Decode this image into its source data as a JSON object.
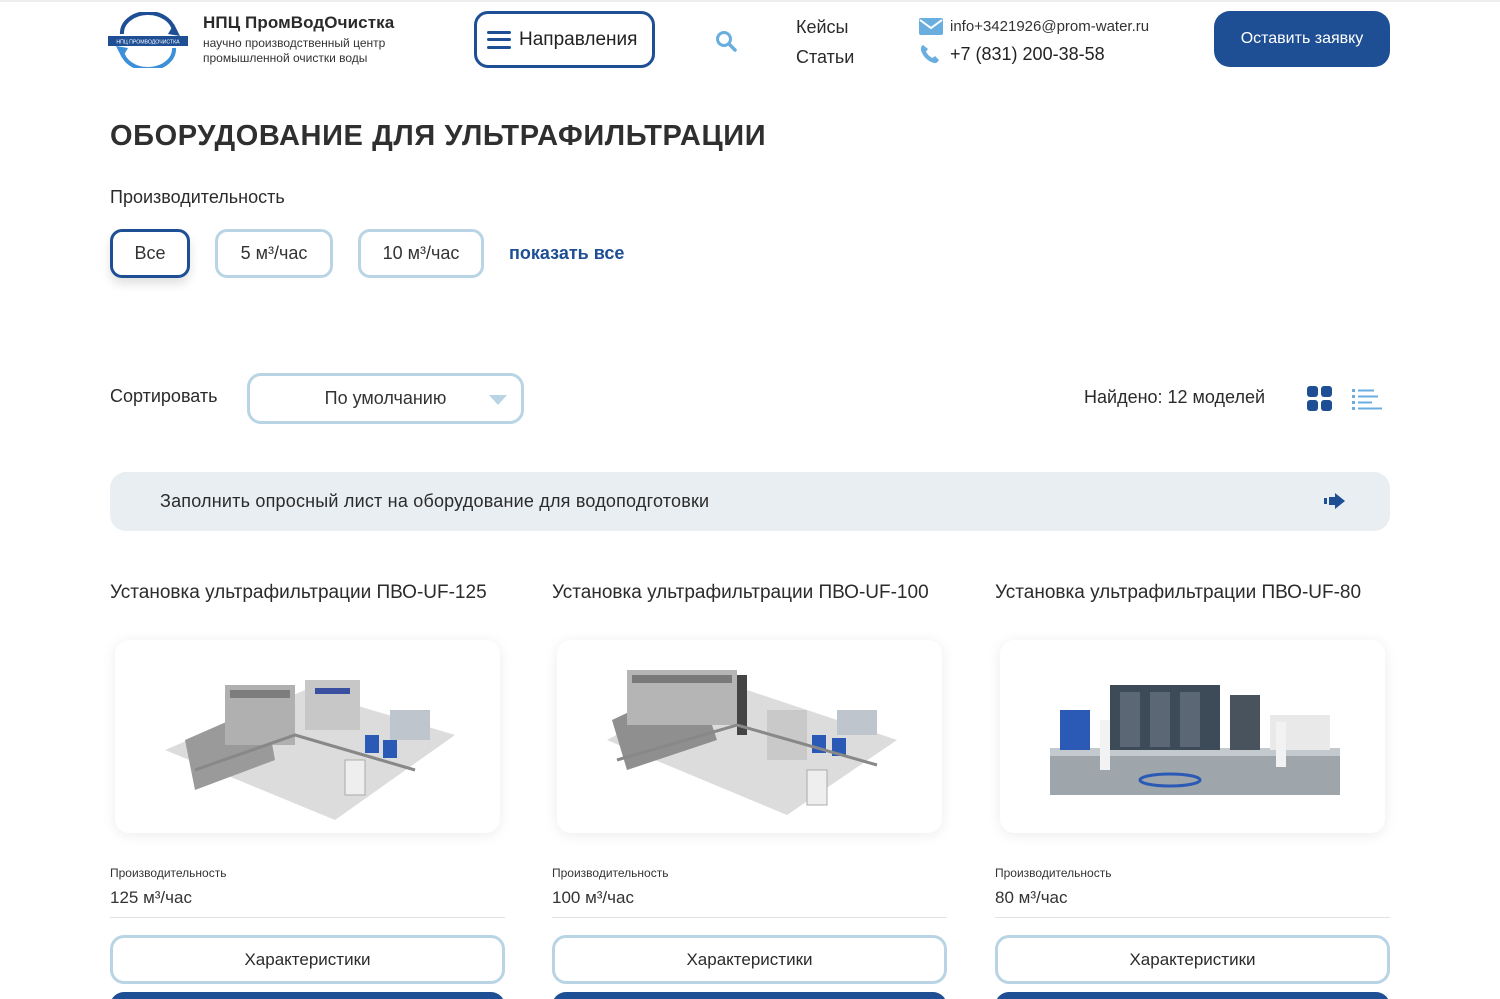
{
  "header": {
    "brand_name": "НПЦ ПромВодОчистка",
    "brand_sub": "научно производственный центр промышленной очистки воды",
    "logo_text": "НПЦ ПРОМВОДОЧИСТКА",
    "directions_label": "Направления",
    "nav": [
      {
        "label": "Кейсы"
      },
      {
        "label": "Статьи"
      }
    ],
    "email": "info+3421926@prom-water.ru",
    "phone": "+7 (831) 200-38-58",
    "cta_label": "Оставить заявку"
  },
  "page": {
    "title": "ОБОРУДОВАНИЕ ДЛЯ УЛЬТРАФИЛЬТРАЦИИ"
  },
  "filter": {
    "label": "Производительность",
    "chips": [
      {
        "label": "Все",
        "active": true
      },
      {
        "label": "5 м³/час",
        "active": false
      },
      {
        "label": "10 м³/час",
        "active": false
      }
    ],
    "show_all": "показать все"
  },
  "sort": {
    "label": "Сортировать",
    "selected": "По умолчанию",
    "found": "Найдено: 12 моделей"
  },
  "banner": {
    "text": "Заполнить опросный лист на оборудование для водоподготовки"
  },
  "products": [
    {
      "title": "Установка ультрафильтрации ПВО-UF-125",
      "spec_label": "Производительность",
      "spec_value": "125 м³/час",
      "button": "Характеристики"
    },
    {
      "title": "Установка ультрафильтрации ПВО-UF-100",
      "spec_label": "Производительность",
      "spec_value": "100 м³/час",
      "button": "Характеристики"
    },
    {
      "title": "Установка ультрафильтрации ПВО-UF-80",
      "spec_label": "Производительность",
      "spec_value": "80 м³/час",
      "button": "Характеристики"
    }
  ],
  "colors": {
    "primary": "#1e4f95",
    "chip_border": "#b9d4e4",
    "banner_bg": "#e9eef2",
    "icon_blue": "#6aaee0"
  },
  "icons": {
    "search": "search-icon",
    "email": "envelope-icon",
    "phone": "phone-icon",
    "grid": "grid-view-icon",
    "list": "list-view-icon",
    "arrow": "arrow-right-icon"
  }
}
